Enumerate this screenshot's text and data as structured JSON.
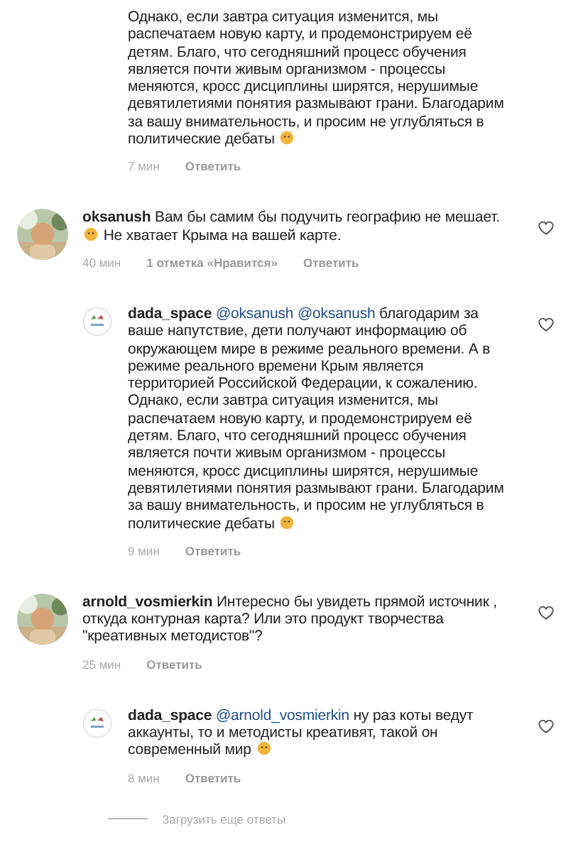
{
  "comments": [
    {
      "kind": "reply",
      "continued": true,
      "heart": false,
      "parts": [
        {
          "kind": "text",
          "text": "Однако, если завтра ситуация  изменится, мы распечатаем новую карту, и продемонстрируем её детям. Благо, что сегодняшний процесс обучения является почти живым организмом - процессы меняются, кросс дисциплины ширятся, нерушимые девятилетиями понятия размывают грани. Благодарим за вашу внимательность, и просим не углубляться в политические дебаты"
        },
        {
          "kind": "emoji"
        }
      ],
      "time": "7 мин",
      "reply": "Ответить"
    },
    {
      "kind": "top",
      "continued": false,
      "heart": true,
      "parts": [
        {
          "kind": "text",
          "text": "**oksanush** Вам бы самим бы подучить географию не мешает."
        },
        {
          "kind": "emoji"
        },
        {
          "kind": "text",
          "text": "Не хватает Крыма на вашей карте."
        }
      ],
      "time": "40 мин",
      "likes": "1 отметка «Нравится»",
      "reply": "Ответить"
    },
    {
      "kind": "reply",
      "continued": false,
      "heart": true,
      "parts": [
        {
          "kind": "text",
          "text": "**dada_space**"
        },
        {
          "kind": "mention",
          "text": "@oksanush"
        },
        {
          "kind": "mention",
          "text": "@oksanush"
        },
        {
          "kind": "text",
          "text": "благодарим за ваше напутствие, дети получают информацию об окружающем мире в режиме реального времени. А в режиме реального времени Крым является территорией Российской Федерации, к сожалению. Однако, если завтра ситуация  изменится, мы распечатаем новую карту, и продемонстрируем её детям. Благо, что сегодняшний процесс обучения является почти живым организмом - процессы меняются, кросс дисциплины ширятся, нерушимые девятилетиями понятия размывают грани. Благодарим за вашу внимательность, и просим не углубляться в политические дебаты"
        },
        {
          "kind": "emoji"
        }
      ],
      "time": "9 мин",
      "reply": "Ответить"
    },
    {
      "kind": "top",
      "continued": false,
      "heart": true,
      "parts": [
        {
          "kind": "text",
          "text": "**arnold_vosmierkin** Интересно бы увидеть прямой источник , откуда контурная карта?  Или это продукт творчества \"креативных методистов\"?"
        }
      ],
      "time": "25 мин",
      "reply": "Ответить"
    },
    {
      "kind": "reply",
      "continued": false,
      "heart": true,
      "parts": [
        {
          "kind": "text",
          "text": "**dada_space**"
        },
        {
          "kind": "mention",
          "text": "@arnold_vosmierkin"
        },
        {
          "kind": "text",
          "text": "ну раз коты ведут аккаунты, то и методисты креативят, такой он современный мир"
        },
        {
          "kind": "emoji"
        }
      ],
      "time": "8 мин",
      "reply": "Ответить"
    }
  ],
  "load_more": "Загрузить еще ответы"
}
